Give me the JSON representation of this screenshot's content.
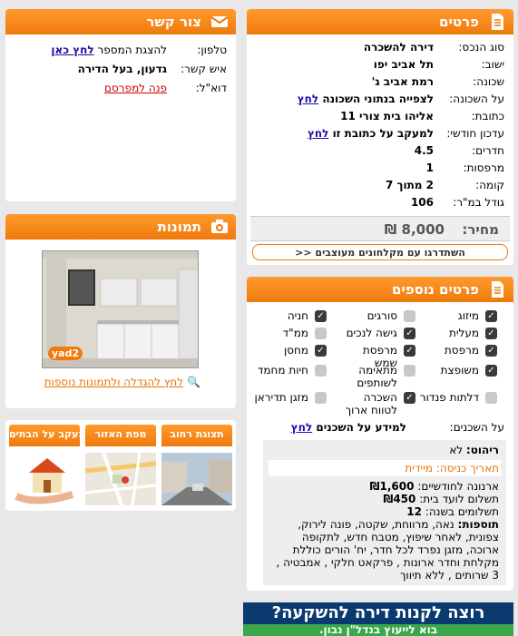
{
  "contact": {
    "title": "צור קשר",
    "phone_label": "טלפון:",
    "phone_text": "להצגת המספר",
    "phone_link": "לחץ כאן",
    "person_label": "איש קשר:",
    "person_value": "גדעון, בעל הדירה",
    "email_label": "דוא\"ל:",
    "email_link": "פנה למפרסם"
  },
  "photos": {
    "title": "תמונות",
    "watermark": "yad2",
    "enlarge_link": "לחץ להגדלה ולתמונות נוספות"
  },
  "tabs": [
    {
      "label": "תצוגת רחוב"
    },
    {
      "label": "מפת האזור"
    },
    {
      "label": "מעקב על הבתים"
    }
  ],
  "details": {
    "title": "פרטים",
    "rows": [
      {
        "label": "סוג הנכס:",
        "value": "דירה להשכרה"
      },
      {
        "label": "ישוב:",
        "value": "תל אביב יפו"
      },
      {
        "label": "שכונה:",
        "value": "רמת אביב ג'"
      },
      {
        "label": "על השכונה:",
        "value": "לצפייה בנתוני השכונה",
        "link": "לחץ"
      },
      {
        "label": "כתובת:",
        "value": "אליהו בית צורי 11"
      },
      {
        "label": "עדכון חודשי:",
        "value": "למעקב על כתובת זו",
        "link": "לחץ"
      },
      {
        "label": "חדרים:",
        "value": "4.5"
      },
      {
        "label": "מרפסות:",
        "value": "1"
      },
      {
        "label": "קומה:",
        "value": "2 מתוך 7"
      },
      {
        "label": "גודל במ\"ר:",
        "value": "106"
      }
    ],
    "price_label": "מחיר:",
    "price_value": "8,000 ₪",
    "agents_button": "השתדרגו עם מקלחונים מעוצבים <<"
  },
  "extra": {
    "title": "פרטים נוספים",
    "features": [
      {
        "label": "מיזוג",
        "checked": true
      },
      {
        "label": "סורגים",
        "checked": false
      },
      {
        "label": "חניה",
        "checked": true
      },
      {
        "label": "מעלית",
        "checked": true
      },
      {
        "label": "גישה לנכים",
        "checked": true
      },
      {
        "label": "ממ\"ד",
        "checked": false
      },
      {
        "label": "מרפסת",
        "checked": true
      },
      {
        "label": "מרפסת שמש",
        "checked": true
      },
      {
        "label": "מחסן",
        "checked": true
      },
      {
        "label": "משופצת",
        "checked": true
      },
      {
        "label": "מתאימה לשותפים",
        "checked": false
      },
      {
        "label": "חיות מחמד",
        "checked": false
      },
      {
        "label": "דלתות פנדור",
        "checked": false
      },
      {
        "label": "השכרה לטווח ארוך",
        "checked": true
      },
      {
        "label": "מזגן תדיראן",
        "checked": false
      }
    ],
    "neighbors_label": "על השכנים:",
    "neighbors_text": "למידע על השכנים",
    "neighbors_link": "לחץ",
    "furnished_label": "ריהוט:",
    "furnished_value": "לא",
    "entry_label": "תאריך כניסה:",
    "entry_value": "מיידית",
    "arnona_label": "ארנונה לחודשיים:",
    "arnona_value": "₪1,600",
    "vaad_label": "תשלום לועד בית:",
    "vaad_value": "₪450",
    "payments_label": "תשלומים בשנה:",
    "payments_value": "12",
    "additions_label": "תוספות:",
    "additions_value": "נאה, מרווחת, שקטה, פונה לירוק, צפונית, לאחר שיפוץ, מטבח חדש, לתקופה ארוכה, מזגן נפרד לכל חדר, יח' הורים כוללת מקלחת וחדר ארונות , פרקאט חלקי , אמבטיה , 3 שרותים , ללא תיווך"
  },
  "banner": {
    "line1": "רוצה לקנות דירה להשקעה?",
    "line2": "בוא לייעוץ בנדל\"ן נבון."
  },
  "colors": {
    "accent": "#f07a0c",
    "link": "#1a0dab"
  }
}
